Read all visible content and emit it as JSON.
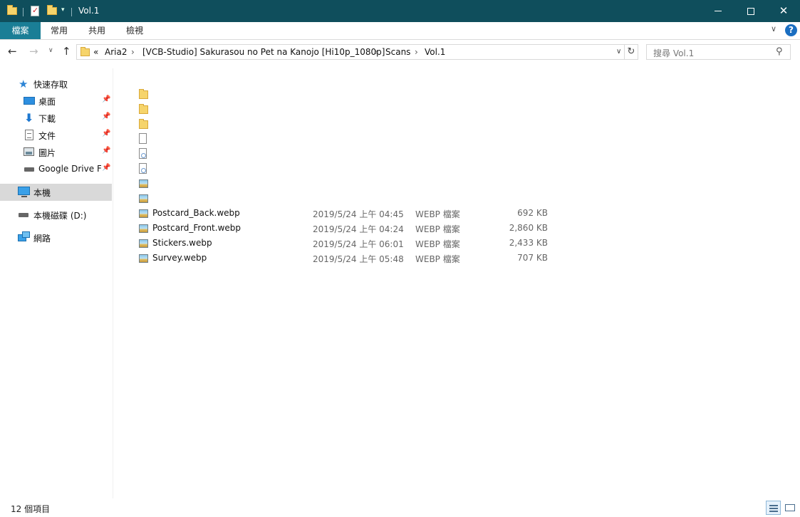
{
  "window": {
    "title": "Vol.1",
    "controls": {
      "minimize": "minimize",
      "maximize": "maximize",
      "close": "✕"
    }
  },
  "ribbon": {
    "tabs": [
      {
        "label": "檔案"
      },
      {
        "label": "常用"
      },
      {
        "label": "共用"
      },
      {
        "label": "檢視"
      }
    ],
    "help": "?"
  },
  "address": {
    "overflow": "«",
    "crumbs": [
      "Aria2",
      "[VCB-Studio] Sakurasou no Pet na Kanojo [Hi10p_1080p]",
      "Scans",
      "Vol.1"
    ]
  },
  "search": {
    "placeholder": "搜尋 Vol.1"
  },
  "sidebar": {
    "quick_access": "快速存取",
    "items": [
      {
        "label": "桌面",
        "icon": "desktop-icon",
        "pinned": true
      },
      {
        "label": "下載",
        "icon": "download-icon",
        "pinned": true
      },
      {
        "label": "文件",
        "icon": "document-icon",
        "pinned": true
      },
      {
        "label": "圖片",
        "icon": "pictures-icon",
        "pinned": true
      },
      {
        "label": "Google Drive Fi",
        "icon": "drive-icon",
        "pinned": true
      }
    ],
    "this_pc": "本機",
    "local_disk": "本機磁碟 (D:)",
    "network": "網路"
  },
  "files": [
    {
      "icon": "folder-icon",
      "name": "",
      "date": "",
      "type": "",
      "size": ""
    },
    {
      "icon": "folder-icon",
      "name": "",
      "date": "",
      "type": "",
      "size": ""
    },
    {
      "icon": "folder-icon",
      "name": "",
      "date": "",
      "type": "",
      "size": ""
    },
    {
      "icon": "blank-file-icon",
      "name": "",
      "date": "",
      "type": "",
      "size": ""
    },
    {
      "icon": "image-document-icon",
      "name": "",
      "date": "",
      "type": "",
      "size": ""
    },
    {
      "icon": "image-document-icon",
      "name": "",
      "date": "",
      "type": "",
      "size": ""
    },
    {
      "icon": "image-file-icon",
      "name": "",
      "date": "",
      "type": "",
      "size": ""
    },
    {
      "icon": "image-file-icon",
      "name": "",
      "date": "",
      "type": "",
      "size": ""
    },
    {
      "icon": "image-file-icon",
      "name": "Postcard_Back.webp",
      "date": "2019/5/24 上午 04:45",
      "type": "WEBP 檔案",
      "size": "692 KB"
    },
    {
      "icon": "image-file-icon",
      "name": "Postcard_Front.webp",
      "date": "2019/5/24 上午 04:24",
      "type": "WEBP 檔案",
      "size": "2,860 KB"
    },
    {
      "icon": "image-file-icon",
      "name": "Stickers.webp",
      "date": "2019/5/24 上午 06:01",
      "type": "WEBP 檔案",
      "size": "2,433 KB"
    },
    {
      "icon": "image-file-icon",
      "name": "Survey.webp",
      "date": "2019/5/24 上午 05:48",
      "type": "WEBP 檔案",
      "size": "707 KB"
    }
  ],
  "status": {
    "count": "12 個項目"
  },
  "colors": {
    "titlebar": "#0f4e5c",
    "file_tab": "#1a7e96",
    "selected_nav": "#d9d9d9"
  }
}
